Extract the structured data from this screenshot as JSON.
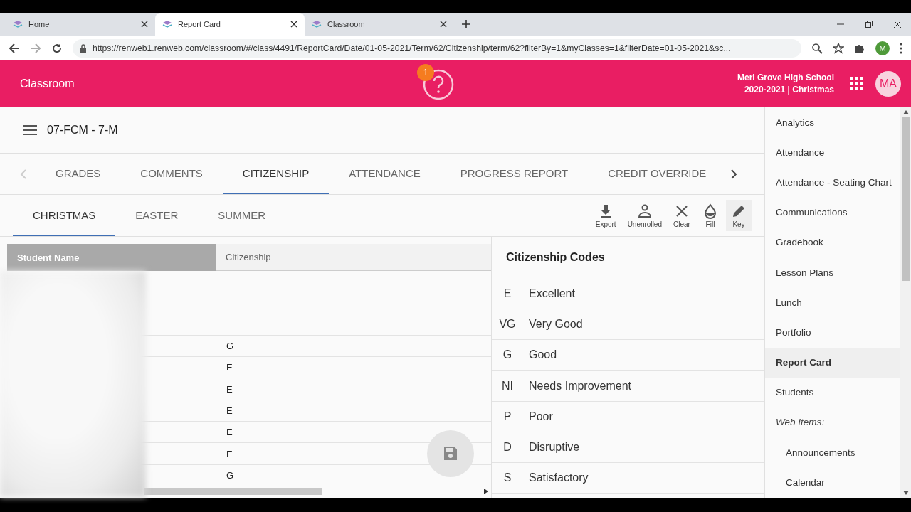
{
  "browser": {
    "tabs": [
      {
        "title": "Home",
        "selected": false
      },
      {
        "title": "Report Card",
        "selected": true
      },
      {
        "title": "Classroom",
        "selected": false
      }
    ],
    "url": "https://renweb1.renweb.com/classroom/#/class/4491/ReportCard/Date/01-05-2021/Term/62/Citizenship/term/62?filterBy=1&myClasses=1&filterDate=01-05-2021&sc...",
    "profile": "M"
  },
  "header": {
    "title": "Classroom",
    "help_badge": "1",
    "school": "Merl Grove High School",
    "term": "2020-2021 | Christmas",
    "avatar": "MA"
  },
  "class_title": "07-FCM - 7-M",
  "tabs": [
    {
      "label": "GRADES",
      "selected": false
    },
    {
      "label": "COMMENTS",
      "selected": false
    },
    {
      "label": "CITIZENSHIP",
      "selected": true
    },
    {
      "label": "ATTENDANCE",
      "selected": false
    },
    {
      "label": "PROGRESS REPORT",
      "selected": false
    },
    {
      "label": "CREDIT OVERRIDE",
      "selected": false
    }
  ],
  "term_tabs": [
    {
      "label": "CHRISTMAS",
      "selected": true
    },
    {
      "label": "EASTER",
      "selected": false
    },
    {
      "label": "SUMMER",
      "selected": false
    }
  ],
  "toolbar": [
    {
      "kind": "export",
      "label": "Export"
    },
    {
      "kind": "unenrolled",
      "label": "Unenrolled"
    },
    {
      "kind": "clear",
      "label": "Clear"
    },
    {
      "kind": "fill",
      "label": "Fill"
    },
    {
      "kind": "key",
      "label": "Key"
    }
  ],
  "table": {
    "columns": [
      "Student Name",
      "Citizenship"
    ],
    "rows": [
      {},
      {},
      {},
      {
        "citizenship": "G"
      },
      {
        "citizenship": "E"
      },
      {
        "citizenship": "E"
      },
      {
        "citizenship": "E"
      },
      {
        "citizenship": "E"
      },
      {
        "citizenship": "E"
      },
      {
        "citizenship": "G"
      }
    ]
  },
  "codes": {
    "title": "Citizenship Codes",
    "items": [
      {
        "code": "E",
        "label": "Excellent"
      },
      {
        "code": "VG",
        "label": "Very Good"
      },
      {
        "code": "G",
        "label": "Good"
      },
      {
        "code": "NI",
        "label": "Needs Improvement"
      },
      {
        "code": "P",
        "label": "Poor"
      },
      {
        "code": "D",
        "label": "Disruptive"
      },
      {
        "code": "S",
        "label": "Satisfactory"
      }
    ]
  },
  "sidebar": {
    "items": [
      {
        "kind": "link",
        "label": "Analytics",
        "selected": false
      },
      {
        "kind": "link",
        "label": "Attendance",
        "selected": false
      },
      {
        "kind": "link",
        "label": "Attendance - Seating Chart",
        "selected": false
      },
      {
        "kind": "link",
        "label": "Communications",
        "selected": false
      },
      {
        "kind": "link",
        "label": "Gradebook",
        "selected": false
      },
      {
        "kind": "link",
        "label": "Lesson Plans",
        "selected": false
      },
      {
        "kind": "link",
        "label": "Lunch",
        "selected": false
      },
      {
        "kind": "link",
        "label": "Portfolio",
        "selected": false
      },
      {
        "kind": "link",
        "label": "Report Card",
        "selected": true
      },
      {
        "kind": "link",
        "label": "Students",
        "selected": false
      },
      {
        "kind": "heading",
        "label": "Web Items:",
        "children": [
          {
            "kind": "link",
            "label": "Announcements",
            "selected": false
          },
          {
            "kind": "link",
            "label": "Calendar",
            "selected": false
          }
        ]
      }
    ]
  }
}
